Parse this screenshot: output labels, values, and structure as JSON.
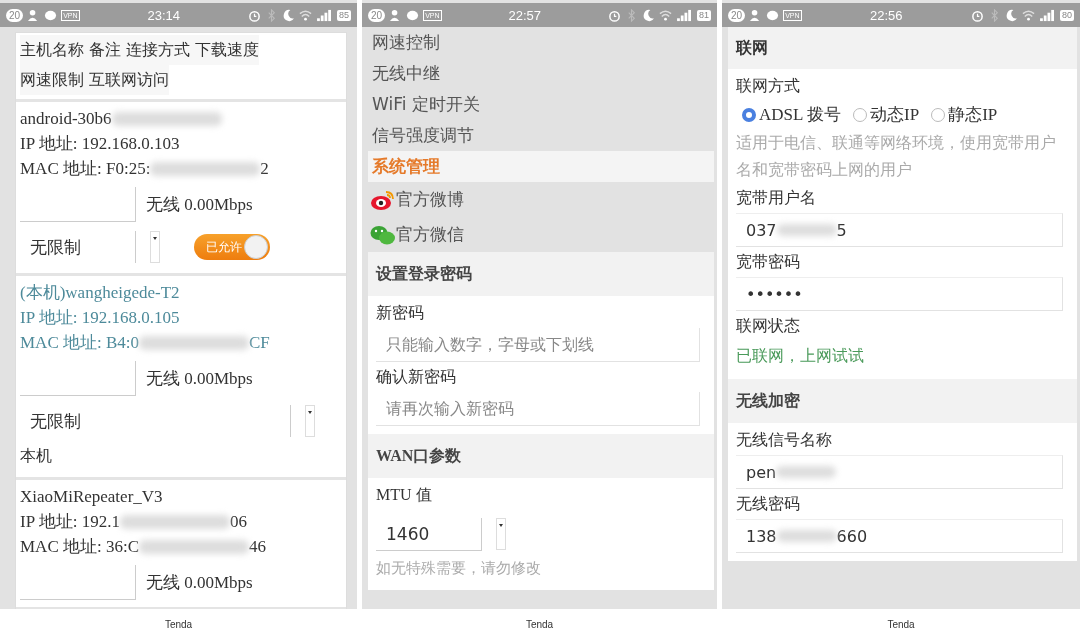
{
  "phones": [
    {
      "status_bar": {
        "badge": "20",
        "vpn": "VPN",
        "time": "23:14",
        "battery": "85"
      },
      "page": {
        "kind": "devices",
        "header": [
          "主机名称 备注 连接方式 下载速度",
          "网速限制 互联网访问"
        ],
        "devices": [
          {
            "local": false,
            "name": {
              "start": "android-30b6",
              "blurred": true
            },
            "ip": {
              "start": "IP 地址: 192.168.0.103"
            },
            "mac": {
              "start": "MAC 地址: F0:25:",
              "blurred": true,
              "end": "2"
            },
            "speed": "无线 0.00Mbps",
            "limit": "无限制",
            "access": {
              "label": "已允许",
              "on": true
            }
          },
          {
            "local": true,
            "name": {
              "start": "(本机)wangheigede-T2"
            },
            "ip": {
              "start": "IP 地址: 192.168.0.105"
            },
            "mac": {
              "start": "MAC 地址: B4:0",
              "blurred": true,
              "end": "CF"
            },
            "speed": "无线 0.00Mbps",
            "limit": "无限制",
            "note": "本机"
          },
          {
            "local": false,
            "name": {
              "start": "XiaoMiRepeater_V3"
            },
            "ip": {
              "start": "IP 地址: 192.1",
              "blurred": true,
              "end": "06"
            },
            "mac": {
              "start": "MAC 地址: 36:C",
              "blurred": true,
              "end": "46"
            },
            "speed": "无线 0.00Mbps"
          }
        ]
      },
      "footer": "Tenda"
    },
    {
      "status_bar": {
        "badge": "20",
        "vpn": "VPN",
        "time": "22:57",
        "battery": "81"
      },
      "page": {
        "kind": "system",
        "menu": [
          {
            "label": "网速控制",
            "selected": false,
            "kind": "text"
          },
          {
            "label": "无线中继",
            "selected": false,
            "kind": "text"
          },
          {
            "label": "WiFi 定时开关",
            "selected": false,
            "kind": "text"
          },
          {
            "label": "信号强度调节",
            "selected": false,
            "kind": "text"
          },
          {
            "label": "系统管理",
            "selected": true,
            "kind": "text"
          },
          {
            "label": "官方微博",
            "selected": false,
            "kind": "weibo"
          },
          {
            "label": "官方微信",
            "selected": false,
            "kind": "wechat"
          }
        ],
        "password_section": {
          "title": "设置登录密码",
          "fields": [
            {
              "label": "新密码",
              "placeholder": "只能输入数字，字母或下划线"
            },
            {
              "label": "确认新密码",
              "placeholder": "请再次输入新密码"
            }
          ]
        },
        "wan_section": {
          "title": "WAN口参数",
          "mtu_label": "MTU 值",
          "mtu_value": "1460",
          "hint": "如无特殊需要，请勿修改"
        }
      },
      "footer": "Tenda"
    },
    {
      "status_bar": {
        "badge": "20",
        "vpn": "VPN",
        "time": "22:56",
        "battery": "80"
      },
      "page": {
        "kind": "network",
        "wan": {
          "title": "联网",
          "mode_label": "联网方式",
          "modes": [
            {
              "label": "ADSL 拨号",
              "selected": true
            },
            {
              "label": "动态IP",
              "selected": false
            },
            {
              "label": "静态IP",
              "selected": false
            }
          ],
          "hint": "适用于电信、联通等网络环境，使用宽带用户名和宽带密码上网的用户",
          "fields": [
            {
              "label": "宽带用户名",
              "value": {
                "start": "037",
                "blurred": true,
                "end": "5"
              }
            },
            {
              "label": "宽带密码",
              "value": {
                "start": "••••••"
              }
            }
          ],
          "status_label": "联网状态",
          "status": "已联网，上网试试",
          "connected": true
        },
        "wireless": {
          "title": "无线加密",
          "fields": [
            {
              "label": "无线信号名称",
              "value": {
                "start": "pen",
                "blurred": true
              }
            },
            {
              "label": "无线密码",
              "value": {
                "start": "138",
                "blurred": true,
                "end": "660"
              }
            }
          ]
        }
      },
      "footer": "Tenda"
    }
  ]
}
